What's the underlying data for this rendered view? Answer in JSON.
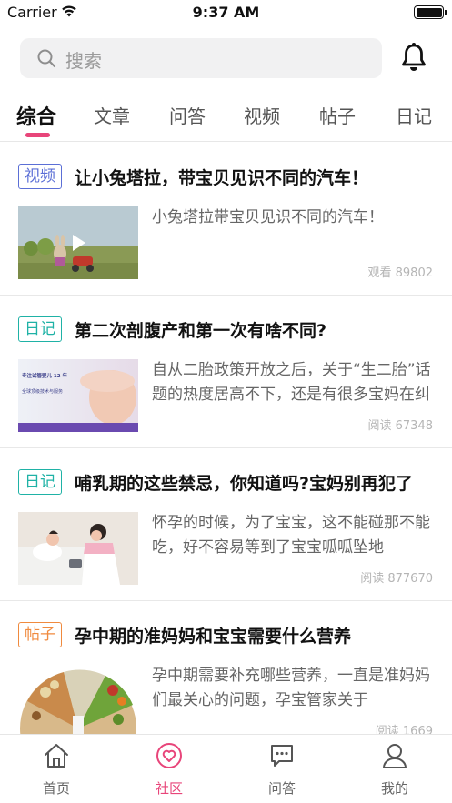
{
  "status_bar": {
    "carrier": "Carrier",
    "time": "9:37 AM",
    "battery_level": 1.0
  },
  "search": {
    "placeholder": "搜索"
  },
  "tabs": [
    {
      "label": "综合",
      "active": true
    },
    {
      "label": "文章"
    },
    {
      "label": "问答"
    },
    {
      "label": "视频"
    },
    {
      "label": "帖子"
    },
    {
      "label": "日记"
    }
  ],
  "feed": [
    {
      "badge": "视频",
      "badge_color": "#5b6fd6",
      "title": "让小兔塔拉，带宝贝见识不同的汽车！",
      "excerpt": "小兔塔拉带宝贝见识不同的汽车！",
      "meta": "观看 89802",
      "thumb": "video-play-icon"
    },
    {
      "badge": "日记",
      "badge_color": "#1fb2a6",
      "title": "第二次剖腹产和第一次有啥不同?",
      "excerpt": "自从二胎政策开放之后，关于“生二胎”话题的热度居高不下，还是有很多宝妈在纠结",
      "meta": "阅读 67348",
      "thumb": "pregnancy-photo",
      "thumb_caption_1": "专注试管婴儿 12 年",
      "thumb_caption_2": "全球顶级技术与服务"
    },
    {
      "badge": "日记",
      "badge_color": "#1fb2a6",
      "title": "哺乳期的这些禁忌，你知道吗?宝妈别再犯了",
      "excerpt": "怀孕的时候，为了宝宝，这不能碰那不能吃，好不容易等到了宝宝呱呱坠地",
      "meta": "阅读 877670",
      "thumb": "nurse-photo"
    },
    {
      "badge": "帖子",
      "badge_color": "#f08a3e",
      "title": "孕中期的准妈妈和宝宝需要什么营养",
      "excerpt": "孕中期需要补充哪些营养，一直是准妈妈们最关心的问题，孕宝管家关于",
      "meta": "阅读 1669",
      "thumb": "food-photo"
    }
  ],
  "tabbar": [
    {
      "label": "首页",
      "icon": "home-icon",
      "active": false
    },
    {
      "label": "社区",
      "icon": "community-heart-icon",
      "active": true
    },
    {
      "label": "问答",
      "icon": "chat-bubble-icon",
      "active": false
    },
    {
      "label": "我的",
      "icon": "profile-icon",
      "active": false
    }
  ],
  "colors": {
    "accent": "#e8457a",
    "tabbar_inactive": "#666666"
  }
}
